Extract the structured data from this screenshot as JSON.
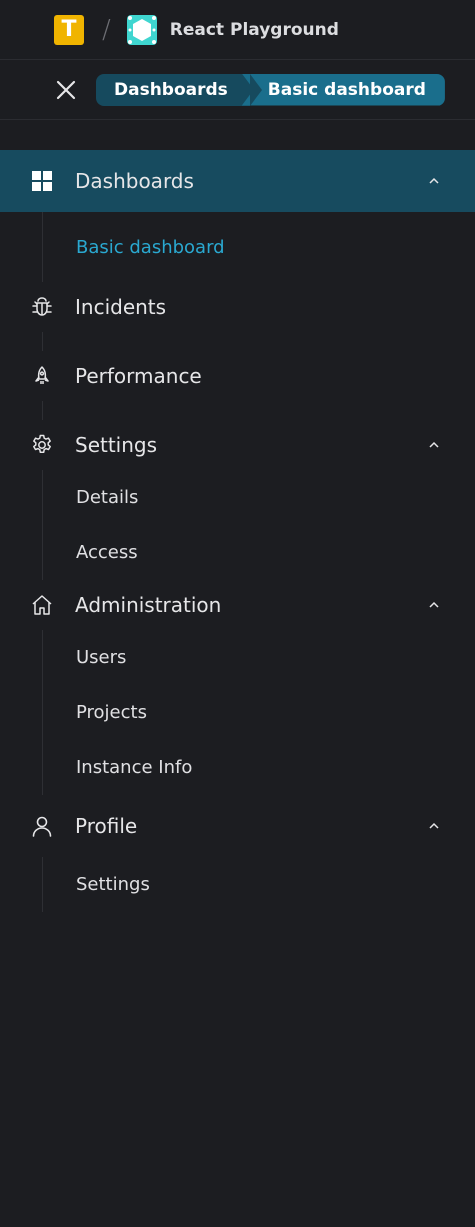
{
  "header": {
    "org_logo_letter": "T",
    "org_logo_color": "#f0b400",
    "separator": "/",
    "project_name": "React Playground",
    "project_icon": "hexagon-pattern-icon",
    "project_icon_color": "#3fd6d0"
  },
  "breadcrumb": {
    "close_icon": "close-icon",
    "items": [
      "Dashboards",
      "Basic dashboard"
    ]
  },
  "nav": {
    "accent": "#2aa8d0",
    "active_bg": "#174b5f",
    "sections": [
      {
        "label": "Dashboards",
        "icon": "grid-icon",
        "expanded": true,
        "active": true,
        "children": [
          "Basic dashboard"
        ],
        "current_child": "Basic dashboard"
      },
      {
        "label": "Incidents",
        "icon": "bug-icon"
      },
      {
        "label": "Performance",
        "icon": "rocket-icon"
      },
      {
        "label": "Settings",
        "icon": "gear-icon",
        "expanded": true,
        "children": [
          "Details",
          "Access"
        ]
      },
      {
        "label": "Administration",
        "icon": "home-icon",
        "expanded": true,
        "children": [
          "Users",
          "Projects",
          "Instance Info"
        ]
      },
      {
        "label": "Profile",
        "icon": "user-icon",
        "expanded": true,
        "children": [
          "Settings"
        ]
      }
    ]
  }
}
